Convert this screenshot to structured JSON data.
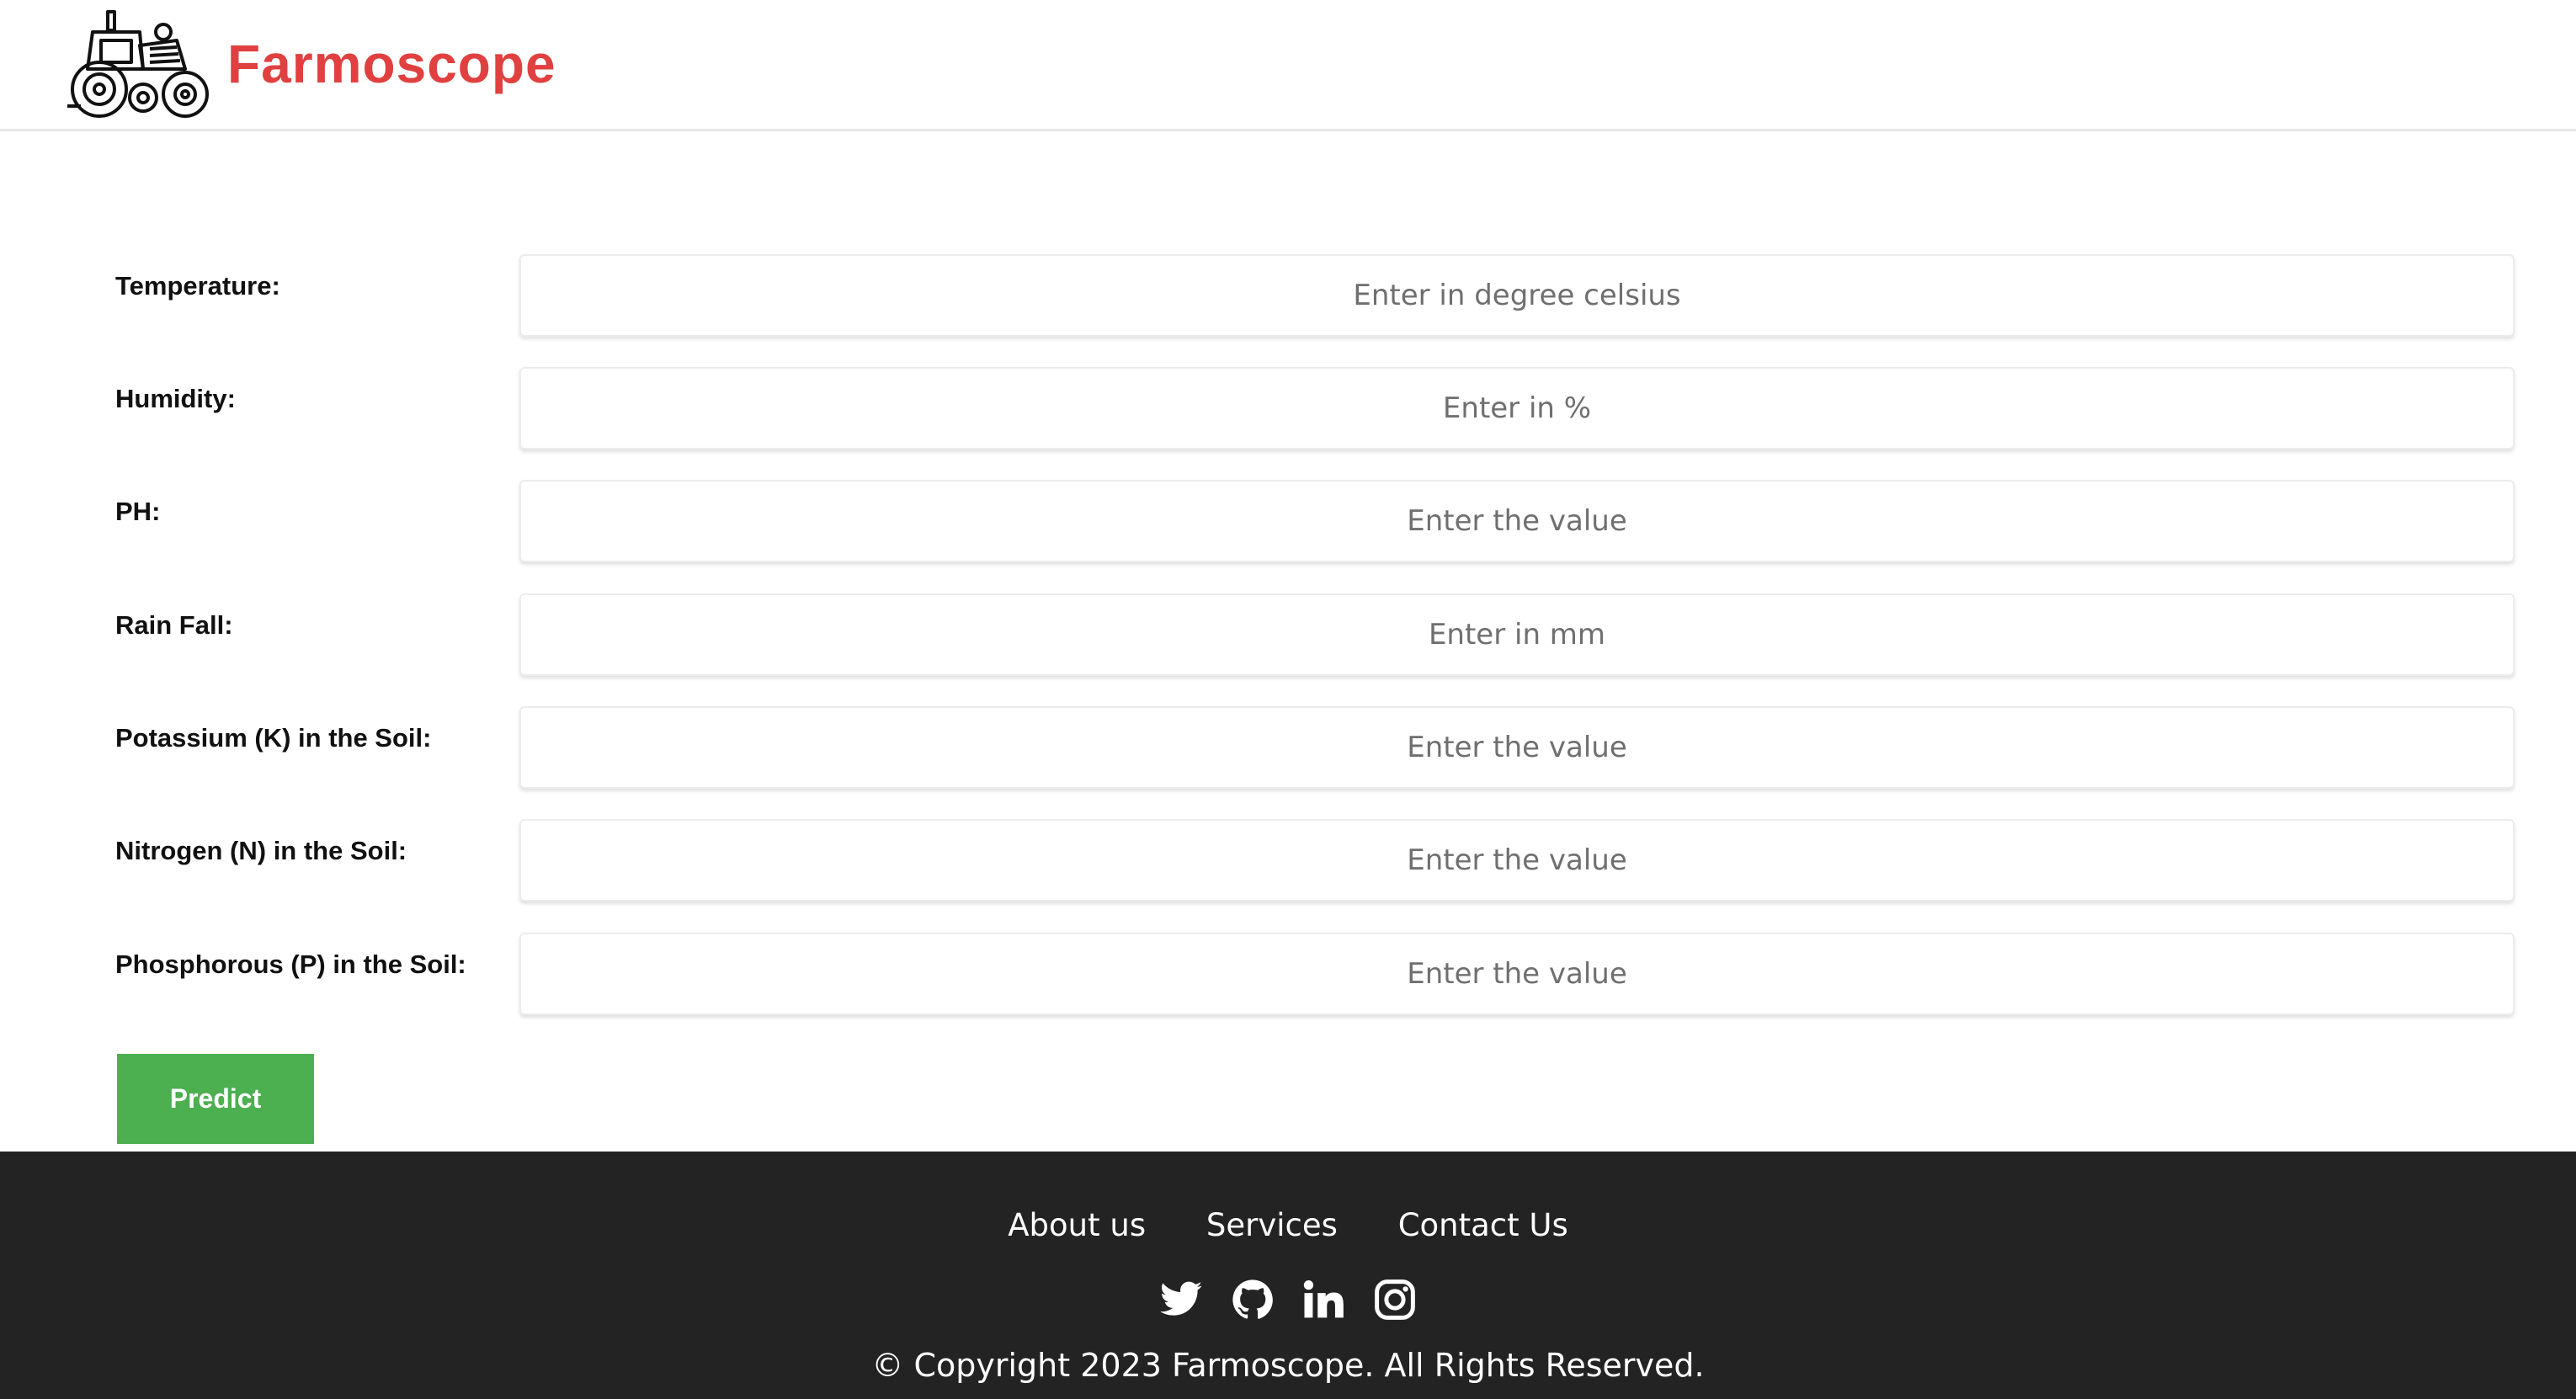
{
  "header": {
    "brand": "Farmoscope",
    "logo_icon": "tractor-icon",
    "brand_color": "#e04040"
  },
  "form": {
    "fields": [
      {
        "label": "Temperature:",
        "placeholder": "Enter in degree celsius"
      },
      {
        "label": "Humidity:",
        "placeholder": "Enter in %"
      },
      {
        "label": "PH:",
        "placeholder": "Enter the value"
      },
      {
        "label": "Rain Fall:",
        "placeholder": "Enter in mm"
      },
      {
        "label": "Potassium (K) in the Soil:",
        "placeholder": "Enter the value"
      },
      {
        "label": "Nitrogen (N) in the Soil:",
        "placeholder": "Enter the value"
      },
      {
        "label": "Phosphorous (P) in the Soil:",
        "placeholder": "Enter the value"
      }
    ],
    "submit_label": "Predict",
    "submit_color": "#4caf50"
  },
  "footer": {
    "links": [
      "About us",
      "Services",
      "Contact Us"
    ],
    "social_icons": [
      "twitter-icon",
      "github-icon",
      "linkedin-icon",
      "instagram-icon"
    ],
    "copyright": "© Copyright 2023 Farmoscope. All Rights Reserved.",
    "background": "#232323"
  }
}
